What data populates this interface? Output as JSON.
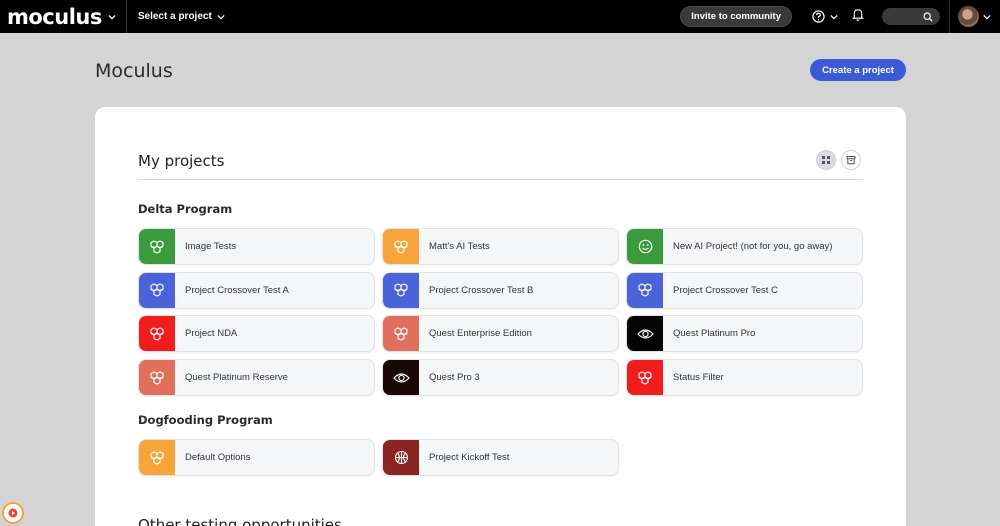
{
  "topbar": {
    "logo": "moculus",
    "project_select": "Select a project",
    "invite_label": "Invite to community"
  },
  "page": {
    "title": "Moculus",
    "create_label": "Create a project"
  },
  "my_projects": {
    "title": "My projects",
    "groups": [
      {
        "name": "Delta Program",
        "projects": [
          {
            "label": "Image Tests",
            "color": "#3b9a3c",
            "icon": "cubes-icon"
          },
          {
            "label": "Matt's AI Tests",
            "color": "#f7a53a",
            "icon": "cubes-icon"
          },
          {
            "label": "New AI Project! (not for you, go away)",
            "color": "#3b9a3c",
            "icon": "smiley-icon"
          },
          {
            "label": "Project Crossover Test A",
            "color": "#4a63d8",
            "icon": "cubes-icon"
          },
          {
            "label": "Project Crossover Test B",
            "color": "#4a63d8",
            "icon": "cubes-icon"
          },
          {
            "label": "Project Crossover Test C",
            "color": "#4a63d8",
            "icon": "cubes-icon"
          },
          {
            "label": "Project NDA",
            "color": "#f01d1d",
            "icon": "cubes-icon"
          },
          {
            "label": "Quest Enterprise Edition",
            "color": "#e06f5c",
            "icon": "cubes-icon"
          },
          {
            "label": "Quest Platinum Pro",
            "color": "#060404",
            "icon": "eye-icon"
          },
          {
            "label": "Quest Platinum Reserve",
            "color": "#e06f5c",
            "icon": "cubes-icon"
          },
          {
            "label": "Quest Pro 3",
            "color": "#1a0808",
            "icon": "eye-icon"
          },
          {
            "label": "Status Filter",
            "color": "#f01d1d",
            "icon": "cubes-icon"
          }
        ]
      },
      {
        "name": "Dogfooding Program",
        "projects": [
          {
            "label": "Default Options",
            "color": "#f7a53a",
            "icon": "cubes-icon"
          },
          {
            "label": "Project Kickoff Test",
            "color": "#8b2424",
            "icon": "ball-icon"
          }
        ]
      }
    ]
  },
  "other": {
    "title": "Other testing opportunities"
  },
  "colors": {
    "topbar": "#000000",
    "accent": "#3b5bd6",
    "background": "#d4d4d4"
  }
}
